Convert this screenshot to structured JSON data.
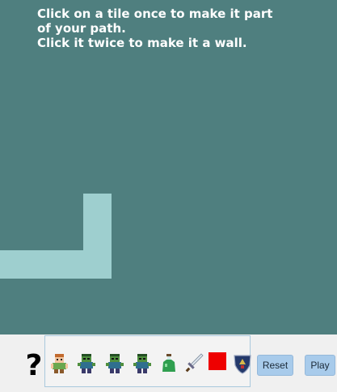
{
  "instructions": {
    "line1": "Click on a tile once to make it part",
    "line2": "of your path.",
    "line3": "Click it twice to make it a wall."
  },
  "toolbar": {
    "help_label": "?",
    "reset_label": "Reset",
    "play_label": "Play"
  },
  "palette": {
    "items": [
      "hero-icon",
      "zombie-icon",
      "zombie-icon",
      "zombie-icon",
      "potion-icon",
      "sword-icon",
      "red-block-icon",
      "shield-icon"
    ]
  },
  "colors": {
    "board": "#4f7f7f",
    "path_tile": "#9ecfcf",
    "toolbar": "#f0f0f0",
    "button": "#a8cbeb"
  }
}
